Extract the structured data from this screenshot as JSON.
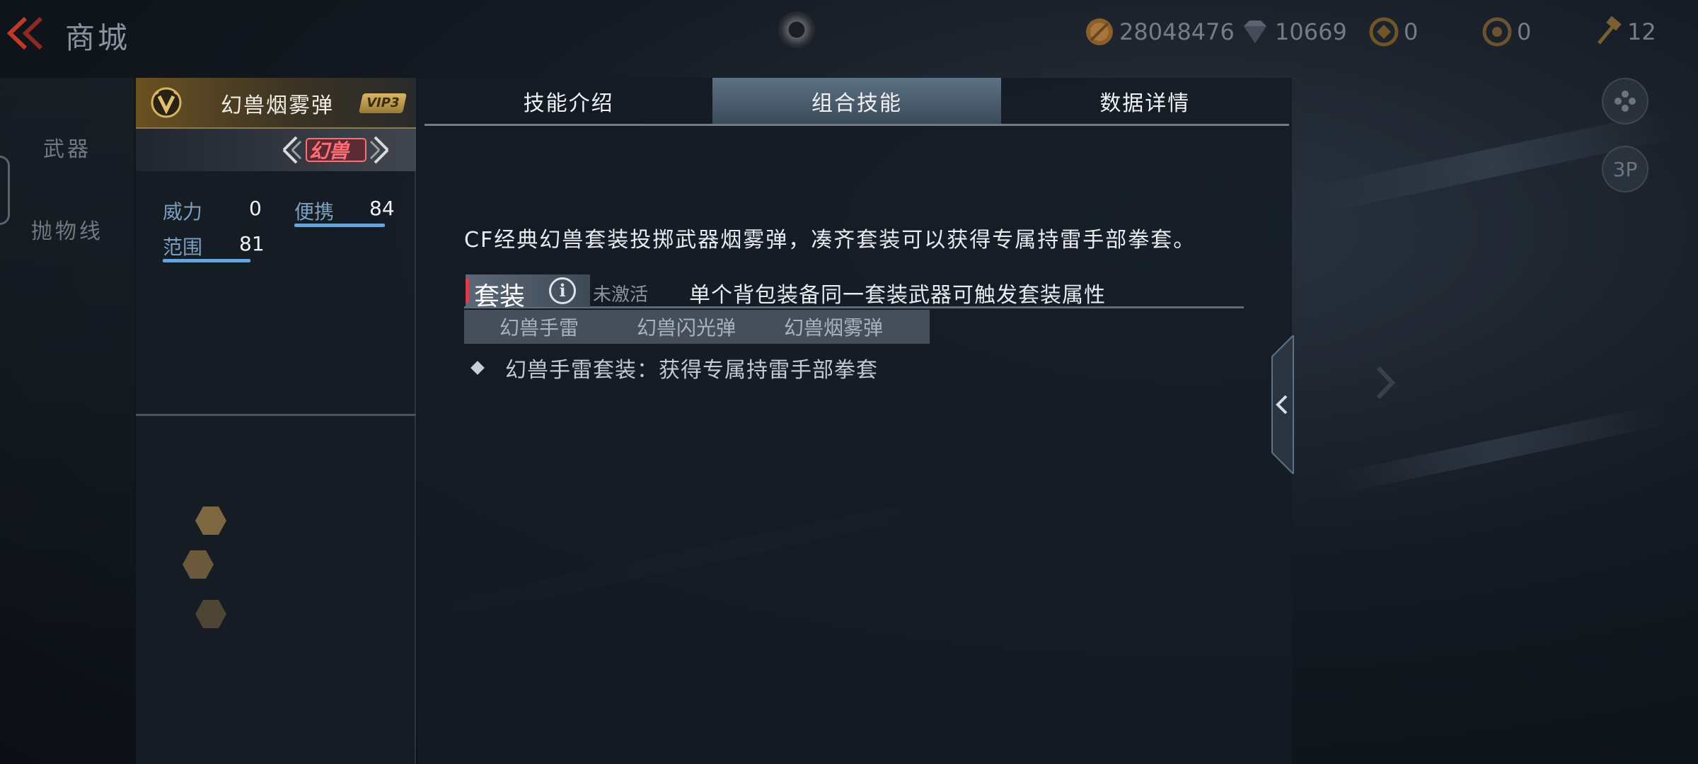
{
  "header": {
    "title": "商城",
    "currencies": [
      {
        "icon": "gold-coin-icon",
        "value": "28048476"
      },
      {
        "icon": "diamond-icon",
        "value": "10669"
      },
      {
        "icon": "gold-ticket-icon",
        "value": "0"
      },
      {
        "icon": "silver-ticket-icon",
        "value": "0"
      },
      {
        "icon": "hammer-icon",
        "value": "12"
      }
    ]
  },
  "sidebar": {
    "items": [
      {
        "label": "武器"
      },
      {
        "label": "抛物线"
      }
    ]
  },
  "side_buttons": {
    "view_3p": "3P"
  },
  "weapon": {
    "name": "幻兽烟雾弹",
    "vip": "VIP3",
    "tag": "幻兽",
    "stats": {
      "power_label": "威力",
      "power_value": "0",
      "carry_label": "便携",
      "carry_value": "84",
      "range_label": "范围",
      "range_value": "81"
    }
  },
  "tabs": [
    {
      "label": "技能介绍",
      "active": false
    },
    {
      "label": "组合技能",
      "active": true
    },
    {
      "label": "数据详情",
      "active": false
    }
  ],
  "content": {
    "description": "CF经典幻兽套装投掷武器烟雾弹，凑齐套装可以获得专属持雷手部拳套。",
    "set_label": "套装",
    "set_status": "未激活",
    "set_hint": "单个背包装备同一套装武器可触发套装属性",
    "members": [
      "幻兽手雷",
      "幻兽闪光弹",
      "幻兽烟雾弹"
    ],
    "bonus": "幻兽手雷套装：获得专属持雷手部拳套"
  },
  "colors": {
    "accent_gold": "#8d7a47",
    "phantom_red": "#ff6e74",
    "stat_blue": "#6aa4d6",
    "active_tab": "#5d7184"
  }
}
